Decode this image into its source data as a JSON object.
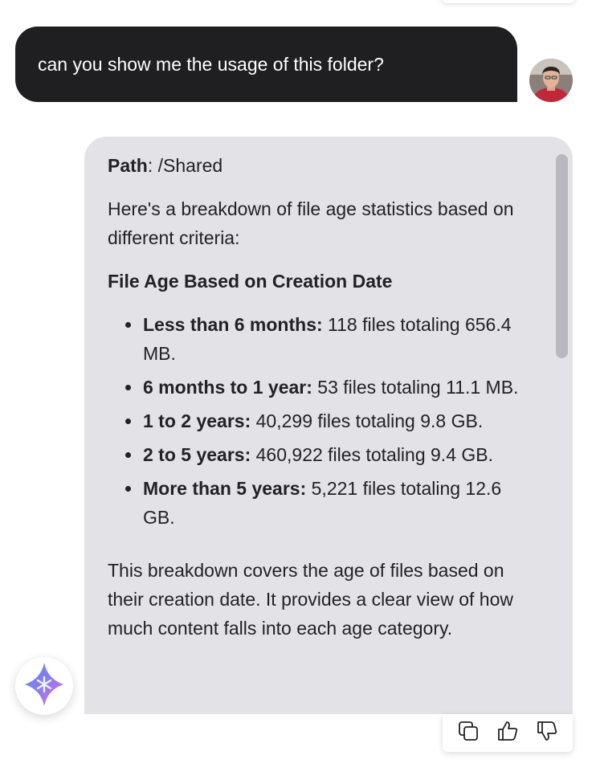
{
  "user_message": {
    "text": "can you show me the usage of this folder?"
  },
  "assistant_message": {
    "path_label": "Path",
    "path_value": ": /Shared",
    "intro": "Here's a breakdown of file age statistics based on different criteria:",
    "section_heading": "File Age Based on Creation Date",
    "items": [
      {
        "label": "Less than 6 months:",
        "detail": " 118 files totaling 656.4 MB."
      },
      {
        "label": "6 months to 1 year:",
        "detail": " 53 files totaling 11.1 MB."
      },
      {
        "label": "1 to 2 years:",
        "detail": " 40,299 files totaling 9.8 GB."
      },
      {
        "label": "2 to 5 years:",
        "detail": " 460,922 files totaling 9.4 GB."
      },
      {
        "label": "More than 5 years:",
        "detail": " 5,221 files totaling 12.6 GB."
      }
    ],
    "summary": "This breakdown covers the age of files based on their creation date. It provides a clear view of how much content falls into each age category."
  },
  "icons": {
    "assistant_logo": "sparkle-star-icon",
    "copy": "copy-icon",
    "like": "thumbs-up-icon",
    "dislike": "thumbs-down-icon"
  },
  "colors": {
    "user_bubble": "#1f1f22",
    "assistant_bubble": "#e3e3e7",
    "scroll_thumb": "#b9b9bd"
  }
}
